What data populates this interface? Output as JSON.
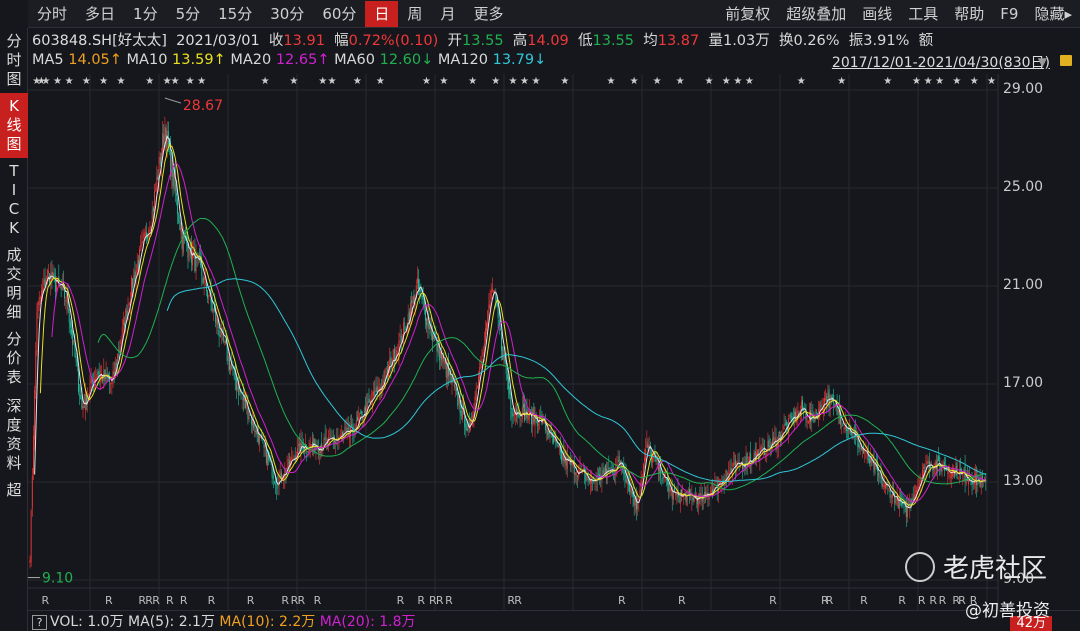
{
  "toolbar": {
    "tabs": [
      "分时",
      "多日",
      "1分",
      "5分",
      "15分",
      "30分",
      "60分",
      "日",
      "周",
      "月",
      "更多"
    ],
    "active": "日",
    "right": [
      "前复权",
      "超级叠加",
      "画线",
      "工具",
      "帮助",
      "F9",
      "隐藏▸"
    ]
  },
  "sidebar": [
    "分\n时\n图",
    "K\n线\n图",
    "T\nI\nC\nK",
    "成\n交\n明\n细",
    "分\n价\n表",
    "深\n度\n资\n料",
    "超"
  ],
  "info": {
    "code": "603848.SH[好太太]",
    "date": "2021/03/01",
    "close_label": "收",
    "close": "13.91",
    "chg_label": "幅",
    "chg": "0.72%(0.10)",
    "open_label": "开",
    "open": "13.55",
    "high_label": "高",
    "high": "14.09",
    "low_label": "低",
    "low": "13.55",
    "avg_label": "均",
    "avg": "13.87",
    "vol": "量1.03万",
    "turnover": "换0.26%",
    "amp": "振3.91%",
    "amount": "额"
  },
  "ma": {
    "ma5": "14.05↑",
    "ma10": "13.59↑",
    "ma20": "12.65↑",
    "ma60": "12.60↓",
    "ma120": "13.79↓"
  },
  "range": "2017/12/01-2021/04/30(830日)",
  "yaxis": [
    "29.00",
    "25.00",
    "21.00",
    "17.00",
    "13.00",
    "9.00"
  ],
  "annotations": {
    "max": "28.67",
    "min": "9.10"
  },
  "volume": {
    "vol": "VOL: 1.0万",
    "ma5": "MA(5): 2.1万",
    "ma10": "MA(10): 2.2万",
    "ma20": "MA(20): 1.8万",
    "axis": "42万"
  },
  "watermark": {
    "brand": "老虎社区",
    "author": "@初善投资"
  },
  "colors": {
    "up": "#f03838",
    "down": "#20c0a0",
    "ma5": "#e8e8e8",
    "ma10": "#e8e020",
    "ma20": "#d020d0",
    "ma60": "#20b050",
    "ma120": "#30c8d8"
  },
  "chart_data": {
    "type": "candlestick",
    "bars": 830,
    "ylim": [
      9,
      29
    ],
    "anchors": [
      [
        0,
        10
      ],
      [
        6,
        20
      ],
      [
        15,
        21.5
      ],
      [
        32,
        20.5
      ],
      [
        45,
        16
      ],
      [
        58,
        17.5
      ],
      [
        71,
        17
      ],
      [
        88,
        21
      ],
      [
        106,
        24
      ],
      [
        117,
        27.5
      ],
      [
        132,
        23
      ],
      [
        149,
        21.5
      ],
      [
        162,
        19.5
      ],
      [
        179,
        17
      ],
      [
        197,
        15
      ],
      [
        214,
        13
      ],
      [
        236,
        14.5
      ],
      [
        253,
        14.5
      ],
      [
        279,
        15
      ],
      [
        305,
        17
      ],
      [
        323,
        19
      ],
      [
        336,
        21
      ],
      [
        349,
        19
      ],
      [
        366,
        17
      ],
      [
        381,
        15
      ],
      [
        401,
        21
      ],
      [
        418,
        16
      ],
      [
        444,
        15.5
      ],
      [
        461,
        14
      ],
      [
        487,
        13
      ],
      [
        513,
        13.8
      ],
      [
        526,
        12
      ],
      [
        535,
        14.5
      ],
      [
        557,
        12.5
      ],
      [
        583,
        12.3
      ],
      [
        609,
        13.5
      ],
      [
        643,
        14.5
      ],
      [
        669,
        16
      ],
      [
        678,
        15.5
      ],
      [
        691,
        16.5
      ],
      [
        713,
        15
      ],
      [
        739,
        13
      ],
      [
        760,
        11.8
      ],
      [
        778,
        13.8
      ],
      [
        799,
        13.5
      ],
      [
        829,
        12.9
      ]
    ],
    "star_bars": [
      2,
      6,
      10,
      20,
      30,
      45,
      60,
      75,
      100,
      115,
      122,
      135,
      145,
      200,
      225,
      250,
      258,
      280,
      300,
      340,
      355,
      380,
      400,
      415,
      425,
      435,
      460,
      500,
      520,
      540,
      560,
      585,
      600,
      610,
      620,
      665,
      700,
      740,
      765,
      775,
      785,
      800,
      815,
      830
    ],
    "r_bars": [
      10,
      65,
      94,
      100,
      106,
      118,
      130,
      154,
      188,
      218,
      226,
      232,
      246,
      318,
      336,
      346,
      352,
      360,
      414,
      420,
      510,
      562,
      641,
      686,
      690,
      720,
      753,
      770,
      780,
      788,
      800,
      805,
      815
    ]
  }
}
